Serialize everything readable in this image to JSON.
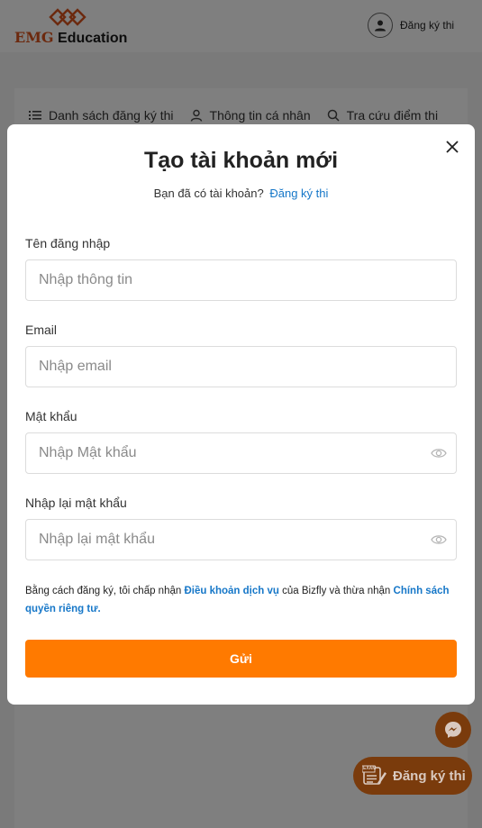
{
  "header": {
    "logo_brand": "EMG",
    "logo_product": "Education",
    "register_label": "Đăng ký thi"
  },
  "tabs": [
    {
      "label": "Danh sách đăng ký thi",
      "icon": "list-icon"
    },
    {
      "label": "Thông tin cá nhân",
      "icon": "user-icon"
    },
    {
      "label": "Tra cứu điểm thi",
      "icon": "search-icon"
    }
  ],
  "modal": {
    "title": "Tạo tài khoản mới",
    "subtitle_text": "Bạn đã có tài khoản?",
    "subtitle_link": "Đăng ký thi",
    "fields": [
      {
        "label": "Tên đăng nhập",
        "placeholder": "Nhập thông tin",
        "value": ""
      },
      {
        "label": "Email",
        "placeholder": "Nhập email",
        "value": ""
      },
      {
        "label": "Mật khẩu",
        "placeholder": "Nhập Mật khẩu",
        "value": ""
      },
      {
        "label": "Nhập lại mật khẩu",
        "placeholder": "Nhập lại mật khẩu",
        "value": ""
      }
    ],
    "terms": {
      "prefix": "Bằng cách đăng ký, tôi chấp nhận",
      "link_terms": "Điều khoản dịch vụ",
      "middle": "của Bizfly và thừa nhận",
      "link_privacy": "Chính sách quyền riêng tư."
    },
    "submit_label": "Gửi"
  },
  "floating": {
    "register_label": "Đăng ký thi",
    "register_icon_text": "EXAM"
  },
  "colors": {
    "accent": "#ff7a00",
    "link": "#1677c8",
    "logo_orange": "#d8521c"
  }
}
